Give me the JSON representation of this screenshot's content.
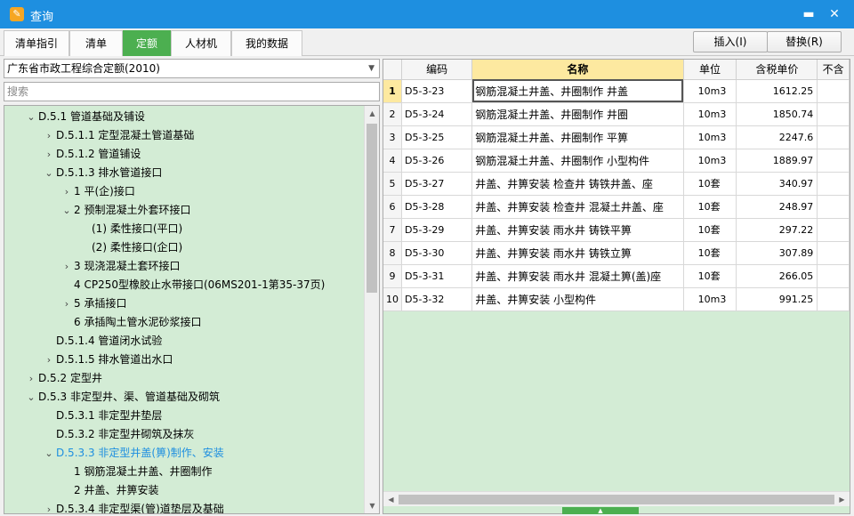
{
  "window": {
    "title": "查询",
    "app_icon": "app-logo-icon",
    "minimize_glyph": "▬",
    "close_glyph": "✕"
  },
  "tabs": [
    {
      "label": "清单指引",
      "active": false
    },
    {
      "label": "清单",
      "active": false
    },
    {
      "label": "定额",
      "active": true
    },
    {
      "label": "人材机",
      "active": false
    },
    {
      "label": "我的数据",
      "active": false
    }
  ],
  "actions": {
    "insert_label": "插入(I)",
    "replace_label": "替换(R)"
  },
  "library": {
    "selected": "广东省市政工程综合定额(2010)"
  },
  "search": {
    "placeholder": "搜索",
    "value": ""
  },
  "tree": [
    {
      "label": "D.5.1 管道基础及铺设",
      "level": 1,
      "state": "expanded"
    },
    {
      "label": "D.5.1.1 定型混凝土管道基础",
      "level": 2,
      "state": "collapsed"
    },
    {
      "label": "D.5.1.2 管道铺设",
      "level": 2,
      "state": "collapsed"
    },
    {
      "label": "D.5.1.3 排水管道接口",
      "level": 2,
      "state": "expanded"
    },
    {
      "label": "1 平(企)接口",
      "level": 3,
      "state": "collapsed"
    },
    {
      "label": "2 预制混凝土外套环接口",
      "level": 3,
      "state": "expanded"
    },
    {
      "label": "(1) 柔性接口(平口)",
      "level": 4,
      "state": "leaf"
    },
    {
      "label": "(2) 柔性接口(企口)",
      "level": 4,
      "state": "leaf"
    },
    {
      "label": "3 现浇混凝土套环接口",
      "level": 3,
      "state": "collapsed"
    },
    {
      "label": "4 CP250型橡胶止水带接口(06MS201-1第35-37页)",
      "level": 3,
      "state": "leaf"
    },
    {
      "label": "5 承插接口",
      "level": 3,
      "state": "collapsed"
    },
    {
      "label": "6 承插陶土管水泥砂浆接口",
      "level": 3,
      "state": "leaf"
    },
    {
      "label": "D.5.1.4 管道闭水试验",
      "level": 2,
      "state": "leaf"
    },
    {
      "label": "D.5.1.5 排水管道出水口",
      "level": 2,
      "state": "collapsed"
    },
    {
      "label": "D.5.2 定型井",
      "level": 1,
      "state": "collapsed"
    },
    {
      "label": "D.5.3 非定型井、渠、管道基础及砌筑",
      "level": 1,
      "state": "expanded"
    },
    {
      "label": "D.5.3.1 非定型井垫层",
      "level": 2,
      "state": "leaf"
    },
    {
      "label": "D.5.3.2 非定型井砌筑及抹灰",
      "level": 2,
      "state": "leaf"
    },
    {
      "label": "D.5.3.3 非定型井盖(箅)制作、安装",
      "level": 2,
      "state": "expanded",
      "selected": true
    },
    {
      "label": "1 钢筋混凝土井盖、井圈制作",
      "level": 3,
      "state": "leaf"
    },
    {
      "label": "2 井盖、井箅安装",
      "level": 3,
      "state": "leaf"
    },
    {
      "label": "D.5.3.4 非定型渠(管)道垫层及基础",
      "level": 2,
      "state": "collapsed"
    }
  ],
  "table": {
    "columns": [
      "编码",
      "名称",
      "单位",
      "含税单价",
      "不含"
    ],
    "rows": [
      {
        "num": "1",
        "code": "D5-3-23",
        "name": "钢筋混凝土井盖、井圈制作 井盖",
        "unit": "10m3",
        "price": "1612.25"
      },
      {
        "num": "2",
        "code": "D5-3-24",
        "name": "钢筋混凝土井盖、井圈制作 井圈",
        "unit": "10m3",
        "price": "1850.74"
      },
      {
        "num": "3",
        "code": "D5-3-25",
        "name": "钢筋混凝土井盖、井圈制作 平箅",
        "unit": "10m3",
        "price": "2247.6"
      },
      {
        "num": "4",
        "code": "D5-3-26",
        "name": "钢筋混凝土井盖、井圈制作 小型构件",
        "unit": "10m3",
        "price": "1889.97"
      },
      {
        "num": "5",
        "code": "D5-3-27",
        "name": "井盖、井箅安装 检查井 铸铁井盖、座",
        "unit": "10套",
        "price": "340.97"
      },
      {
        "num": "6",
        "code": "D5-3-28",
        "name": "井盖、井箅安装 检查井 混凝土井盖、座",
        "unit": "10套",
        "price": "248.97"
      },
      {
        "num": "7",
        "code": "D5-3-29",
        "name": "井盖、井箅安装 雨水井 铸铁平箅",
        "unit": "10套",
        "price": "297.22"
      },
      {
        "num": "8",
        "code": "D5-3-30",
        "name": "井盖、井箅安装 雨水井 铸铁立箅",
        "unit": "10套",
        "price": "307.89"
      },
      {
        "num": "9",
        "code": "D5-3-31",
        "name": "井盖、井箅安装 雨水井 混凝土箅(盖)座",
        "unit": "10套",
        "price": "266.05"
      },
      {
        "num": "10",
        "code": "D5-3-32",
        "name": "井盖、井箅安装 小型构件",
        "unit": "10m3",
        "price": "991.25"
      }
    ]
  }
}
